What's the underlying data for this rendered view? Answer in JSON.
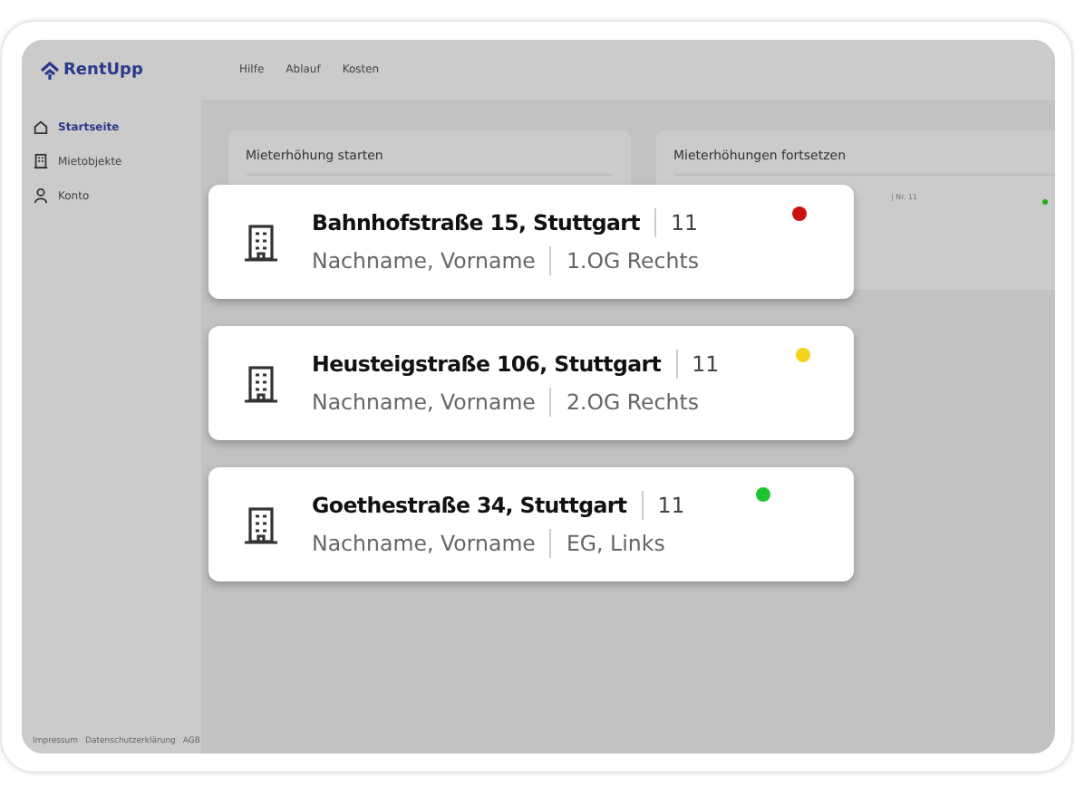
{
  "header": {
    "logo": "RentUpp",
    "nav": [
      "Hilfe",
      "Ablauf",
      "Kosten"
    ]
  },
  "sidebar": {
    "items": [
      {
        "label": "Startseite",
        "kind": "home",
        "selected": true
      },
      {
        "label": "Mietobjekte",
        "kind": "building",
        "selected": false
      },
      {
        "label": "Konto",
        "kind": "person",
        "selected": false
      }
    ],
    "footer_links": [
      "Impressum",
      "Datenschutzerklärung",
      "AGB"
    ]
  },
  "panels": [
    {
      "title": "Mieterhöhung starten"
    },
    {
      "title": "Mieterhöhungen fortsetzen",
      "entry": "| Nr. 11",
      "color": "#22aa22"
    }
  ],
  "properties": [
    {
      "address": "Bahnhofstraße 15, Stuttgart",
      "number": "11",
      "tenant": "Nachname, Vorname",
      "unit": "1.OG Rechts",
      "color": "#cc1111"
    },
    {
      "address": "Heusteigstraße 106, Stuttgart",
      "number": "11",
      "tenant": "Nachname, Vorname",
      "unit": "2.OG Rechts",
      "color": "#f2d21b"
    },
    {
      "address": "Goethestraße 34, Stuttgart",
      "number": "11",
      "tenant": "Nachname, Vorname",
      "unit": "EG, Links",
      "color": "#1fc431"
    }
  ]
}
